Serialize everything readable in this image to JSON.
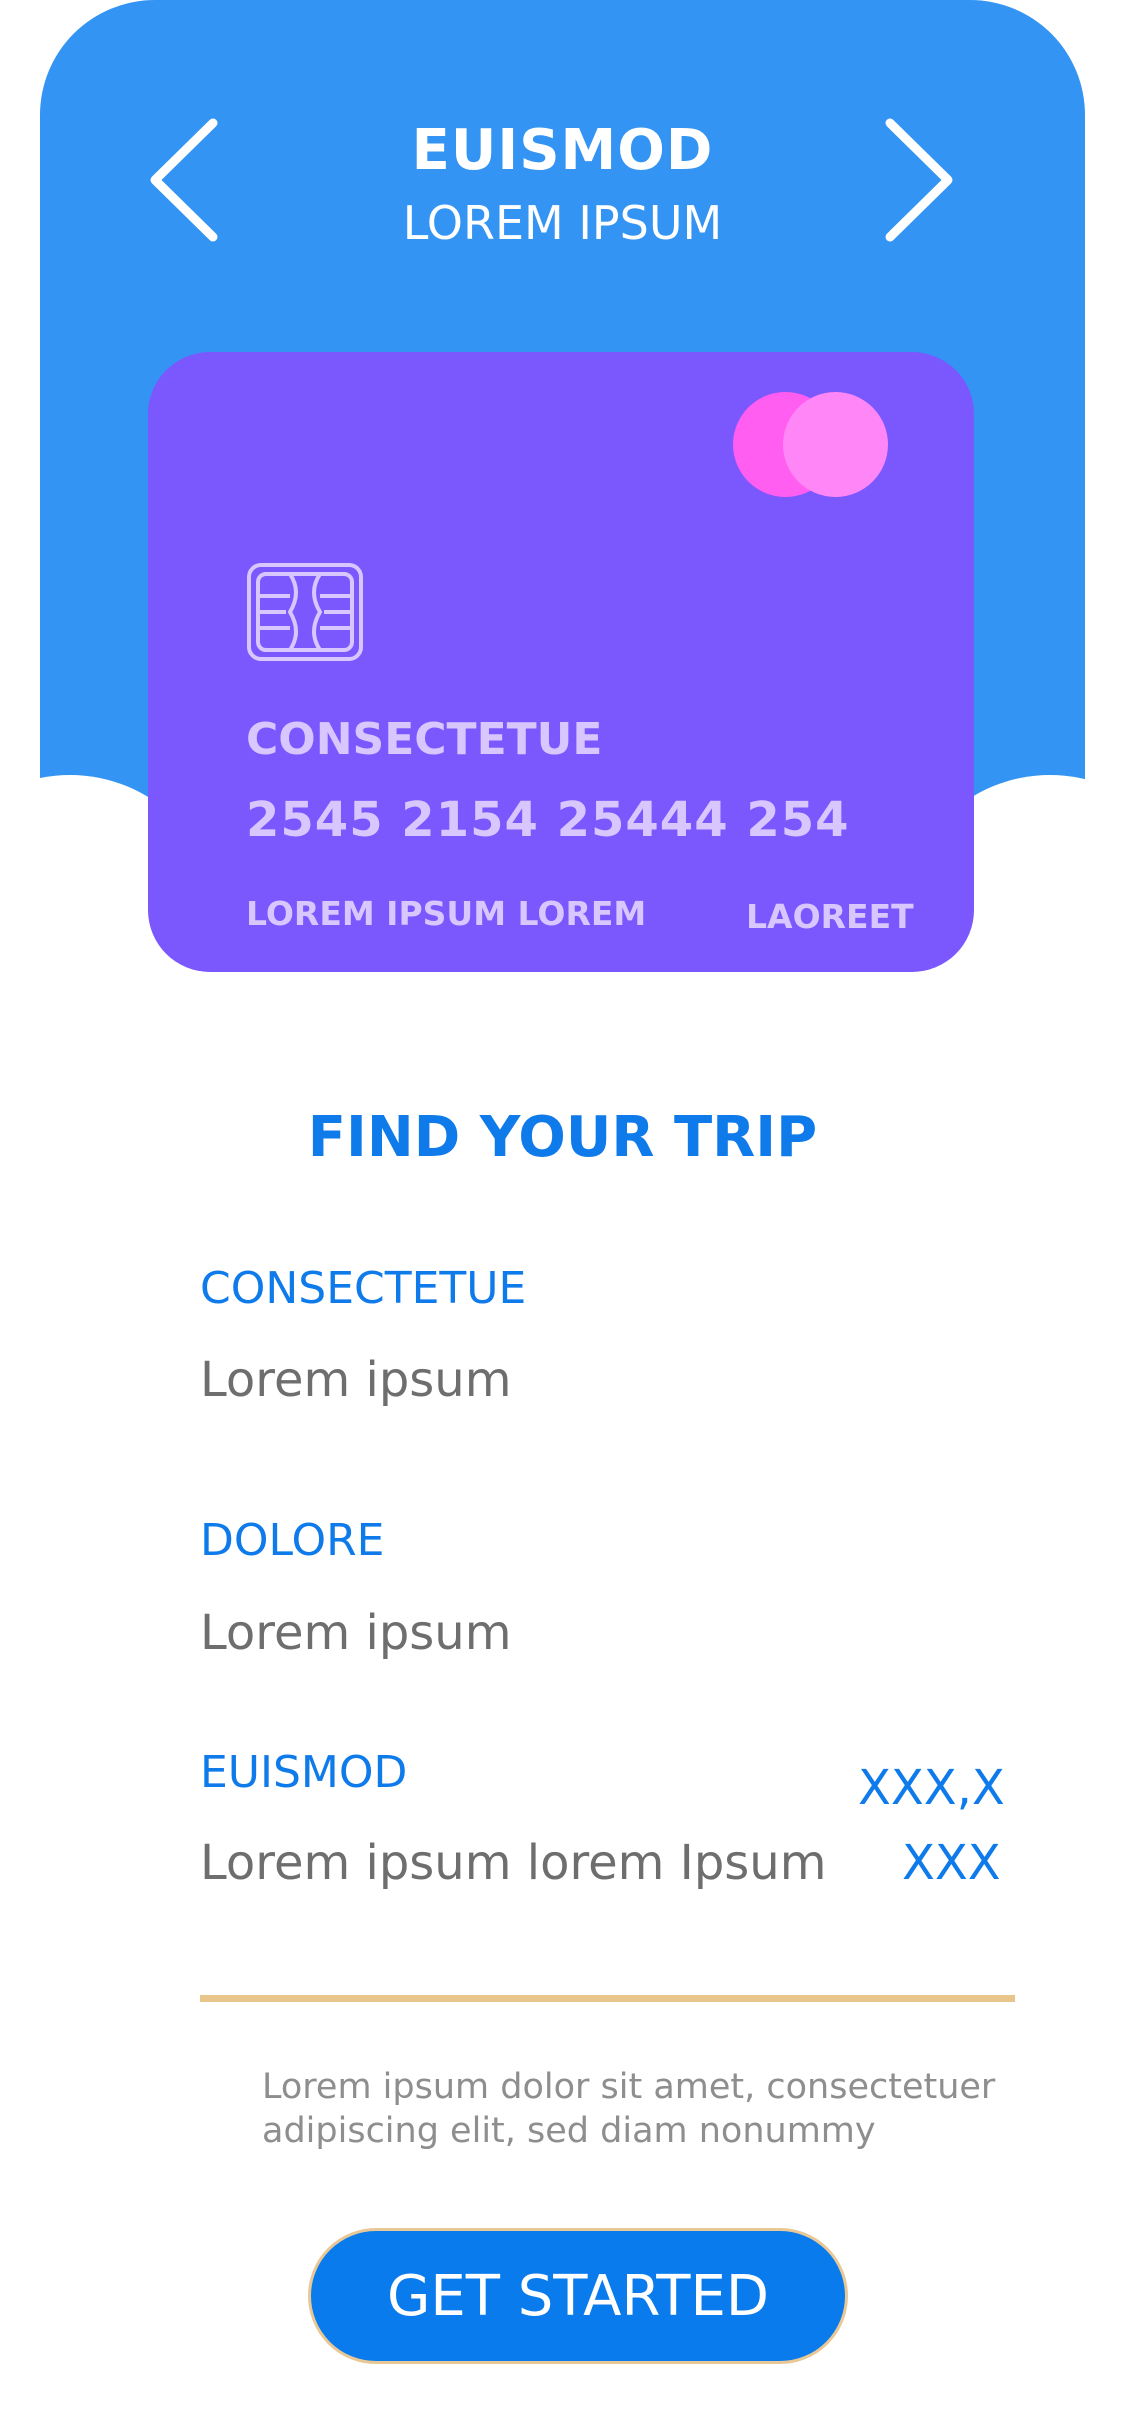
{
  "colors": {
    "header_blue": "#3394f3",
    "card_purple": "#7b57fe",
    "logo_magenta": "#ff5ef0",
    "logo_pink": "#ff86f7",
    "accent_blue": "#0f7bea",
    "gray_text": "#6e6e6e",
    "divider_gold": "#e8c58a",
    "cta_blue": "#0a7bec"
  },
  "header": {
    "title": "EUISMOD",
    "subtitle": "LOREM IPSUM",
    "prev_icon": "chevron-left-icon",
    "next_icon": "chevron-right-icon"
  },
  "card": {
    "label": "CONSECTETUE",
    "number": "2545  2154  25444  254",
    "holder": "LOREM IPSUM  LOREM",
    "expiry": "LAOREET",
    "chip_icon": "card-chip-icon",
    "brand_icon": "card-brand-logo-icon"
  },
  "trip": {
    "title": "FIND YOUR TRIP",
    "fields": [
      {
        "label": "CONSECTETUE",
        "value": "Lorem  ipsum"
      },
      {
        "label": "DOLORE",
        "value": "Lorem  ipsum"
      },
      {
        "label": "EUISMOD",
        "value": "Lorem ipsum lorem Ipsum",
        "price_top": "XXX,X",
        "price_bottom": "XXX"
      }
    ],
    "footnote": "Lorem ipsum dolor sit amet, consectetuer adipiscing elit, sed diam nonummy"
  },
  "cta": {
    "label": "GET STARTED"
  }
}
